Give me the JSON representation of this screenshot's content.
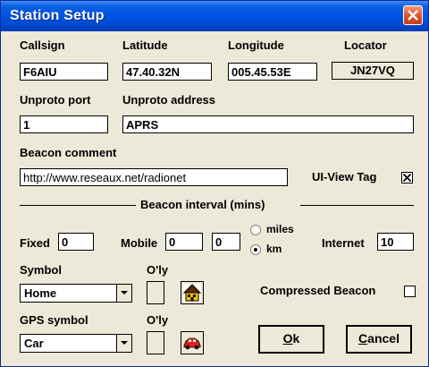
{
  "window": {
    "title": "Station Setup"
  },
  "labels": {
    "callsign": "Callsign",
    "latitude": "Latitude",
    "longitude": "Longitude",
    "locator": "Locator",
    "unproto_port": "Unproto port",
    "unproto_address": "Unproto address",
    "beacon_comment": "Beacon comment",
    "uiview_tag": "UI-View Tag",
    "beacon_interval": "Beacon interval (mins)",
    "fixed": "Fixed",
    "mobile": "Mobile",
    "miles": "miles",
    "km": "km",
    "internet": "Internet",
    "symbol": "Symbol",
    "oly1": "O'ly",
    "gps_symbol": "GPS symbol",
    "oly2": "O'ly",
    "compressed_beacon": "Compressed Beacon"
  },
  "fields": {
    "callsign": "F6AIU",
    "latitude": "47.40.32N",
    "longitude": "005.45.53E",
    "locator": "JN27VQ",
    "unproto_port": "1",
    "unproto_address": "APRS",
    "beacon_comment": "http://www.reseaux.net/radionet",
    "fixed": "0",
    "mobile1": "0",
    "mobile2": "0",
    "internet": "10"
  },
  "checkboxes": {
    "uiview_tag": true,
    "compressed_beacon": false
  },
  "radios": {
    "unit_selected": "km"
  },
  "selects": {
    "symbol": "Home",
    "gps_symbol": "Car"
  },
  "buttons": {
    "ok_key": "O",
    "ok_rest": "k",
    "cancel_key": "C",
    "cancel_rest": "ancel"
  },
  "icons": {
    "symbol": "house-icon",
    "gps_symbol": "car-icon"
  },
  "colors": {
    "titlebar": "#0054e3",
    "dialog_bg": "#ece9d8",
    "close": "#e0552f",
    "house_yellow": "#f5c400",
    "car_red": "#e0201a"
  }
}
